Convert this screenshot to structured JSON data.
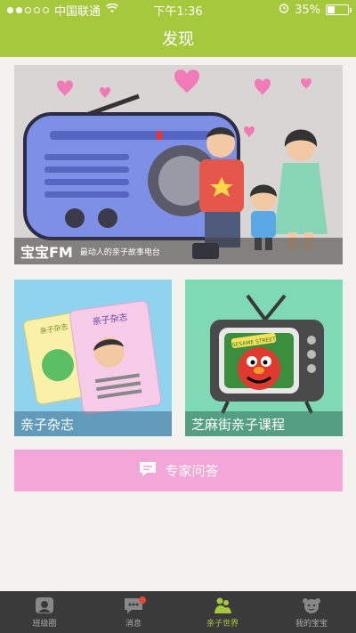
{
  "status": {
    "carrier": "中国联通",
    "time": "下午1:36",
    "battery": "35%",
    "battery_level": 0.35
  },
  "title": "发现",
  "hero": {
    "title": "宝宝FM",
    "subtitle": "最动人的亲子故事电台"
  },
  "cards": [
    {
      "label": "亲子杂志",
      "art_text": "亲子杂志"
    },
    {
      "label": "芝麻街亲子课程",
      "art_text": "SESAME STREET"
    }
  ],
  "expert": {
    "label": "专家问答"
  },
  "tabs": [
    {
      "label": "班级圈",
      "icon": "class-circle-icon"
    },
    {
      "label": "消息",
      "icon": "message-icon"
    },
    {
      "label": "亲子世界",
      "icon": "parent-world-icon"
    },
    {
      "label": "我的宝宝",
      "icon": "baby-icon"
    }
  ],
  "colors": {
    "brand": "#a5c83d",
    "expert": "#f5a6d8",
    "tab_bg": "#3a3a3a"
  }
}
